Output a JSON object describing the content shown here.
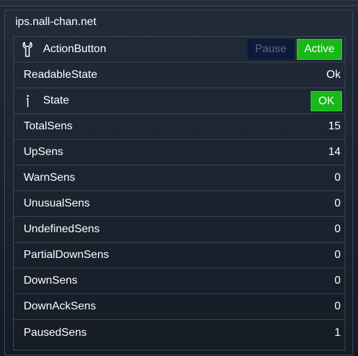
{
  "panel": {
    "title": "ips.nall-chan.net"
  },
  "action": {
    "label": "ActionButton",
    "icon": "wrench-icon",
    "pause_label": "Pause",
    "active_label": "Active",
    "active_color": "#19b719"
  },
  "readable_state": {
    "label": "ReadableState",
    "value": "Ok"
  },
  "state": {
    "label": "State",
    "icon": "info-icon",
    "value": "OK",
    "color": "#19b719"
  },
  "rows": [
    {
      "label": "TotalSens",
      "value": "15"
    },
    {
      "label": "UpSens",
      "value": "14"
    },
    {
      "label": "WarnSens",
      "value": "0"
    },
    {
      "label": "UnusualSens",
      "value": "0"
    },
    {
      "label": "UndefinedSens",
      "value": "0"
    },
    {
      "label": "PartialDownSens",
      "value": "0"
    },
    {
      "label": "DownSens",
      "value": "0"
    },
    {
      "label": "DownAckSens",
      "value": "0"
    },
    {
      "label": "PausedSens",
      "value": "1"
    }
  ]
}
